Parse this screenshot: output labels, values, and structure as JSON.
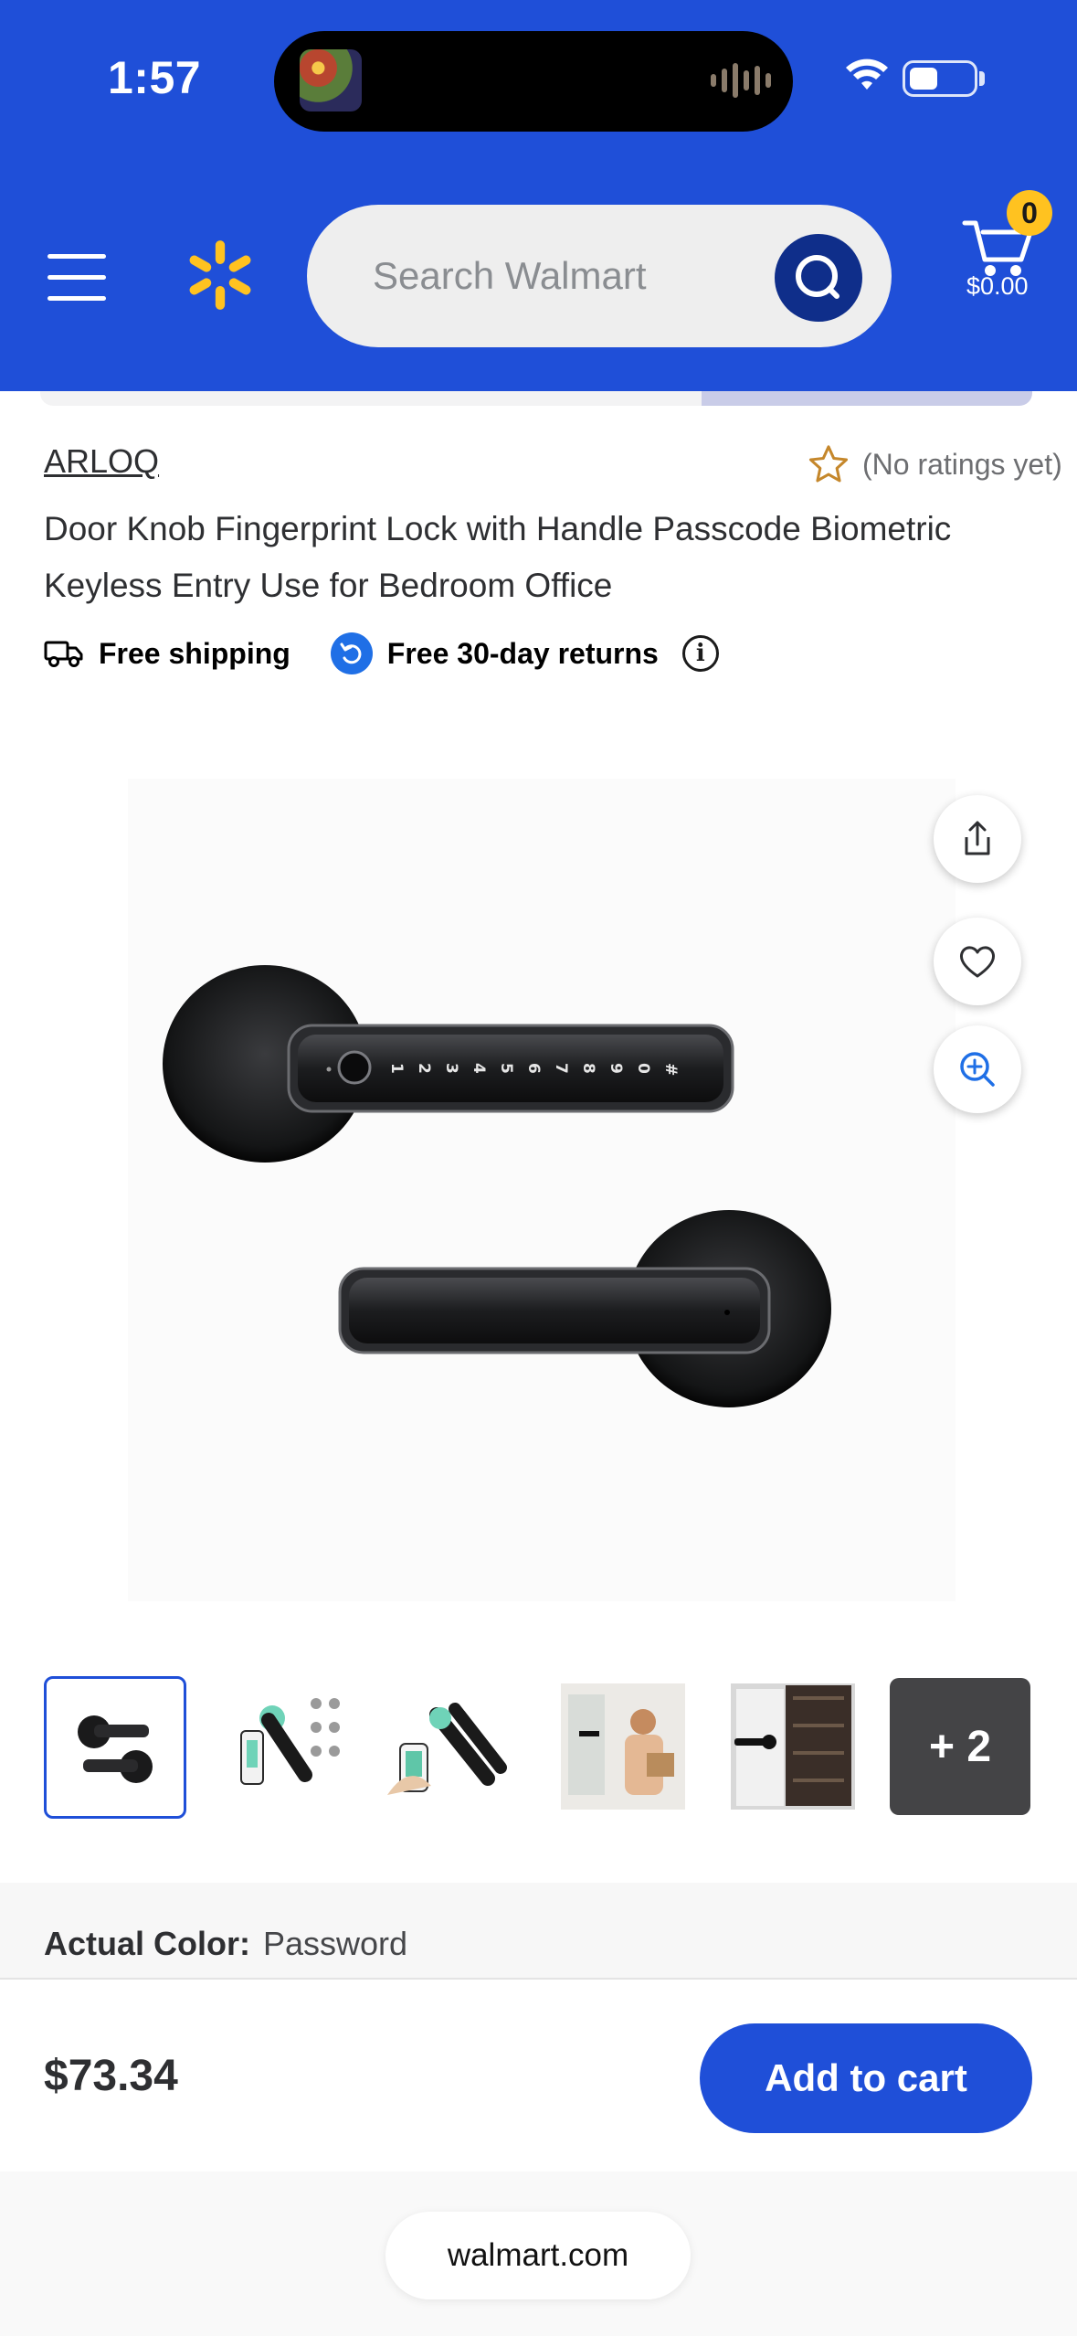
{
  "status_bar": {
    "time": "1:57"
  },
  "header": {
    "search_placeholder": "Search Walmart",
    "cart_count": "0",
    "cart_total": "$0.00",
    "brand_color": "#1f4fd8",
    "spark_color": "#ffc220"
  },
  "product": {
    "brand": "ARLOQ",
    "ratings": "(No ratings yet)",
    "title": "Door Knob Fingerprint Lock with Handle Passcode Biometric Keyless Entry Use for Bedroom Office",
    "free_shipping": "Free shipping",
    "free_returns": "Free 30-day returns",
    "keypad_digits": "1 2 3 4 5 6 7 8 9 0 #",
    "more_images": "+ 2",
    "color_label": "Actual Color:",
    "color_value": "Password",
    "price": "$73.34",
    "add_to_cart": "Add to cart"
  },
  "browser": {
    "url": "walmart.com"
  },
  "icons": [
    "menu-icon",
    "walmart-spark-icon",
    "search-icon",
    "cart-icon",
    "star-icon",
    "truck-icon",
    "return-icon",
    "info-icon",
    "share-icon",
    "heart-icon",
    "zoom-icon",
    "wifi-icon",
    "battery-icon"
  ]
}
